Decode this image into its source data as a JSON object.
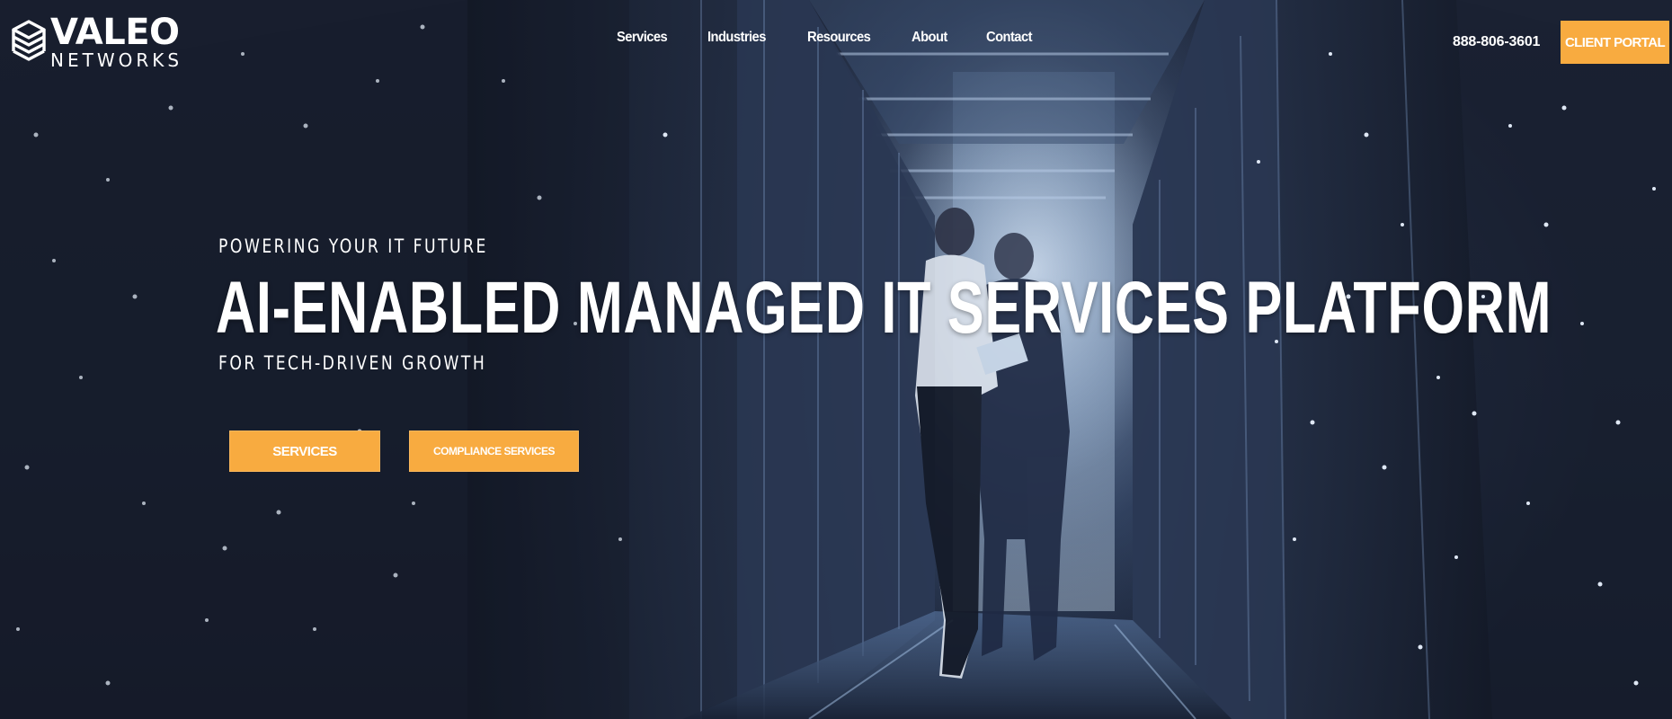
{
  "header": {
    "logo": {
      "word1": "VALEO",
      "word2": "NETWORKS"
    },
    "nav": [
      {
        "label": "Services"
      },
      {
        "label": "Industries"
      },
      {
        "label": "Resources"
      },
      {
        "label": "About"
      },
      {
        "label": "Contact"
      }
    ],
    "phone": "888-806-3601",
    "portal_button": "CLIENT PORTAL"
  },
  "hero": {
    "eyebrow": "POWERING YOUR IT FUTURE",
    "headline": "AI-ENABLED MANAGED IT SERVICES PLATFORM",
    "subline": "FOR TECH-DRIVEN GROWTH",
    "buttons": [
      {
        "label": "SERVICES"
      },
      {
        "label": "COMPLIANCE SERVICES"
      }
    ]
  },
  "colors": {
    "accent": "#f8ab40",
    "background": "#171e2e",
    "text": "#ffffff"
  },
  "icons": [
    "valeo-hexagon-logo-icon"
  ]
}
